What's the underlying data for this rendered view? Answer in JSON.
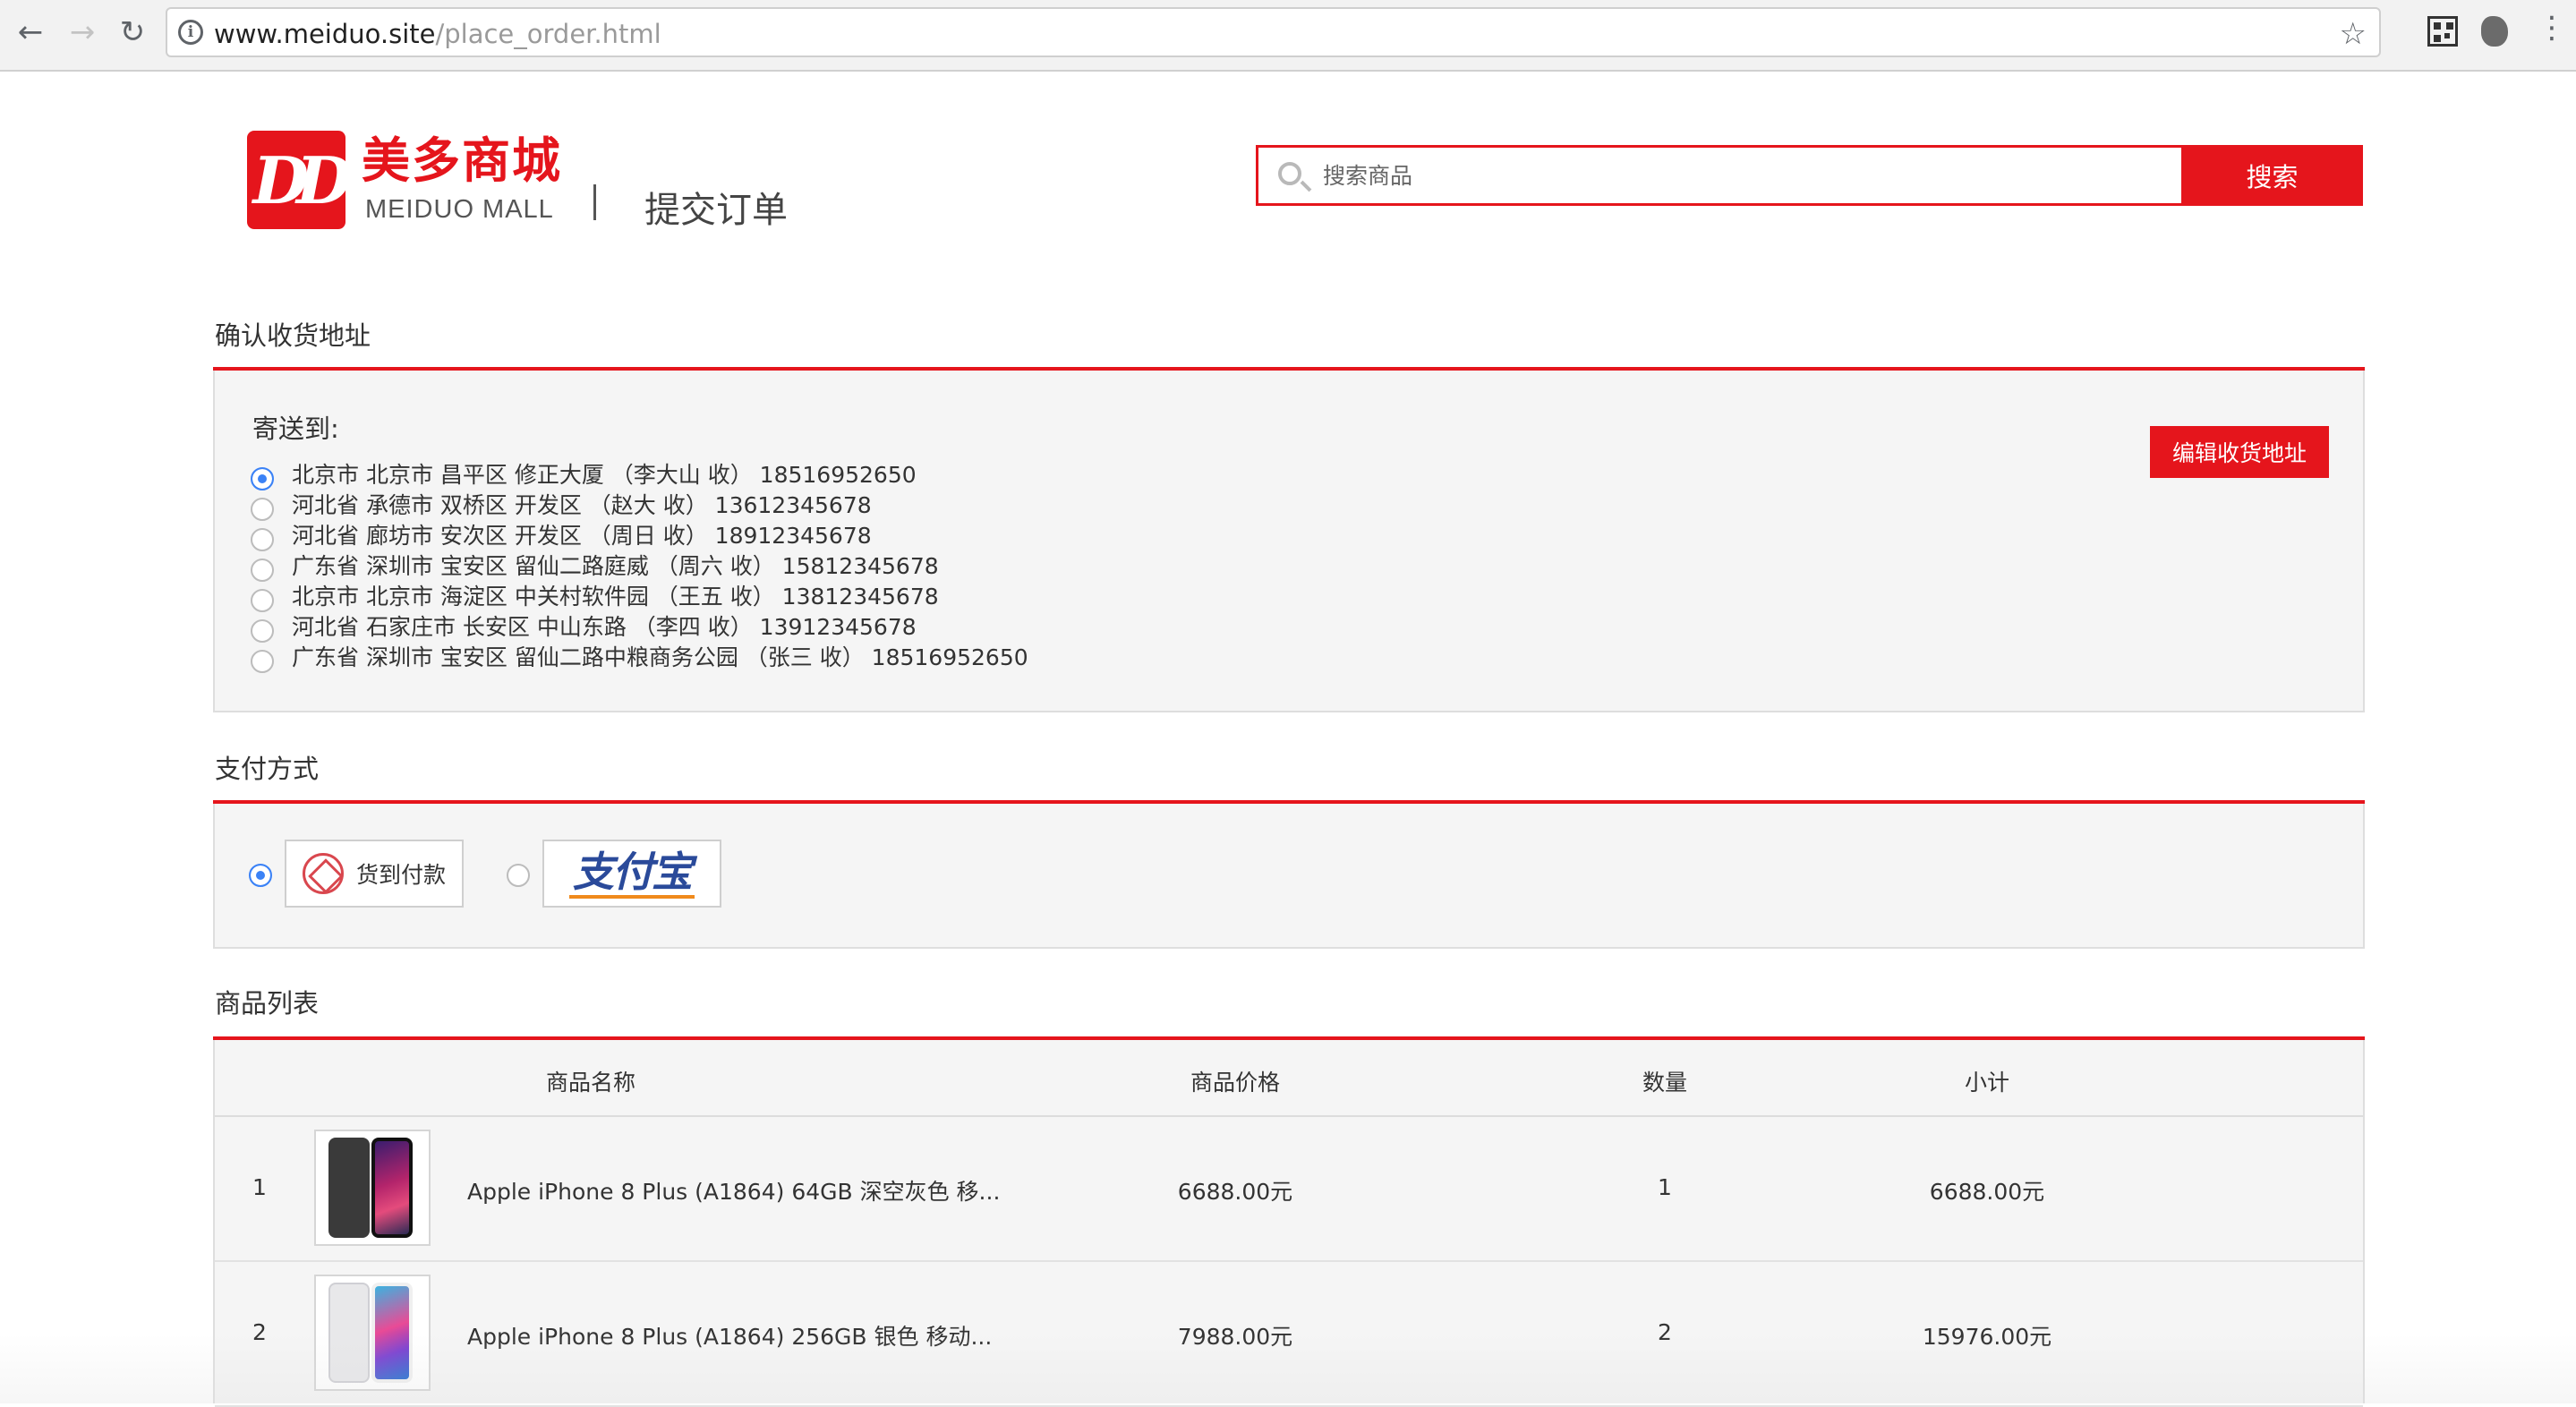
{
  "browser": {
    "url_host": "www.meiduo.site",
    "url_path": "/place_order.html"
  },
  "header": {
    "logo_cn": "美多商城",
    "logo_en": "MEIDUO MALL",
    "page_title": "提交订单",
    "search_placeholder": "搜索商品",
    "search_button": "搜索"
  },
  "address_section": {
    "title": "确认收货地址",
    "ship_to_label": "寄送到:",
    "edit_button": "编辑收货地址",
    "addresses": [
      {
        "text": "北京市 北京市 昌平区 修正大厦 （李大山 收） 18516952650",
        "selected": true
      },
      {
        "text": "河北省 承德市 双桥区 开发区 （赵大 收） 13612345678",
        "selected": false
      },
      {
        "text": "河北省 廊坊市 安次区 开发区 （周日 收） 18912345678",
        "selected": false
      },
      {
        "text": "广东省 深圳市 宝安区 留仙二路庭威 （周六 收） 15812345678",
        "selected": false
      },
      {
        "text": "北京市 北京市 海淀区 中关村软件园 （王五 收） 13812345678",
        "selected": false
      },
      {
        "text": "河北省 石家庄市 长安区 中山东路 （李四 收） 13912345678",
        "selected": false
      },
      {
        "text": "广东省 深圳市 宝安区 留仙二路中粮商务公园 （张三 收） 18516952650",
        "selected": false
      }
    ]
  },
  "payment_section": {
    "title": "支付方式",
    "options": [
      {
        "label": "货到付款",
        "icon": "cash-on-delivery-icon",
        "selected": true
      },
      {
        "label": "支付宝",
        "icon": "alipay-logo",
        "selected": false
      }
    ]
  },
  "goods_section": {
    "title": "商品列表",
    "columns": [
      "商品名称",
      "商品价格",
      "数量",
      "小计"
    ],
    "rows": [
      {
        "index": "1",
        "name": "Apple iPhone 8 Plus (A1864) 64GB 深空灰色 移...",
        "price": "6688.00元",
        "quantity": "1",
        "subtotal": "6688.00元"
      },
      {
        "index": "2",
        "name": "Apple iPhone 8 Plus (A1864) 256GB 银色 移动...",
        "price": "7988.00元",
        "quantity": "2",
        "subtotal": "15976.00元"
      }
    ]
  },
  "colors": {
    "brand_red": "#e5151c",
    "radio_blue": "#3b82f6",
    "panel_bg": "#f5f5f5"
  }
}
